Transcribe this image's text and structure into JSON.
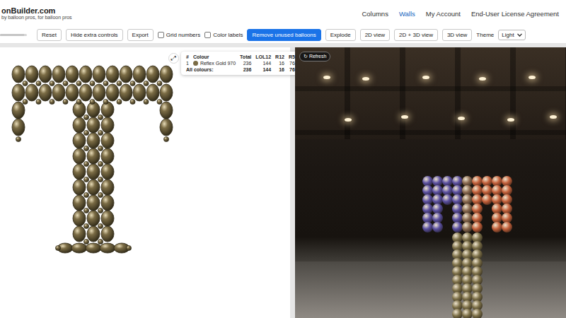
{
  "brand": {
    "name": "onBuilder.com",
    "tagline": "by balloon pros, for balloon pros"
  },
  "nav": [
    {
      "label": "Columns",
      "selected": false
    },
    {
      "label": "Walls",
      "selected": true
    },
    {
      "label": "My Account",
      "selected": false
    },
    {
      "label": "End-User License Agreement",
      "selected": false
    }
  ],
  "toolbar": {
    "slider": {
      "level": 0.9
    },
    "items": [
      {
        "kind": "button",
        "label": "Reset"
      },
      {
        "kind": "button",
        "label": "Hide extra controls"
      },
      {
        "kind": "button",
        "label": "Export"
      },
      {
        "kind": "checkbox",
        "label": "Grid numbers",
        "checked": false
      },
      {
        "kind": "checkbox",
        "label": "Color labels",
        "checked": false
      },
      {
        "kind": "primary",
        "label": "Remove unused balloons"
      },
      {
        "kind": "button",
        "label": "Explode"
      },
      {
        "kind": "button",
        "label": "2D view"
      },
      {
        "kind": "button",
        "label": "2D + 3D view"
      },
      {
        "kind": "button",
        "label": "3D view"
      }
    ],
    "theme": {
      "label": "Theme",
      "value": "Light"
    }
  },
  "expand_button": "⤢",
  "legend": {
    "columns": [
      "#",
      "Colour",
      "Total",
      "LOL12",
      "R12",
      "R5"
    ],
    "rows": [
      {
        "index": "1",
        "colour": "Reflex Gold 970",
        "color": "#7b6c45",
        "total": "236",
        "lol12": "144",
        "r12": "16",
        "r5": "76"
      }
    ],
    "totals": {
      "label": "All colours:",
      "total": "236",
      "lol12": "144",
      "r12": "16",
      "r5": "76"
    }
  },
  "preview": {
    "refresh_icon": "↻",
    "refresh_label": "Refresh"
  }
}
